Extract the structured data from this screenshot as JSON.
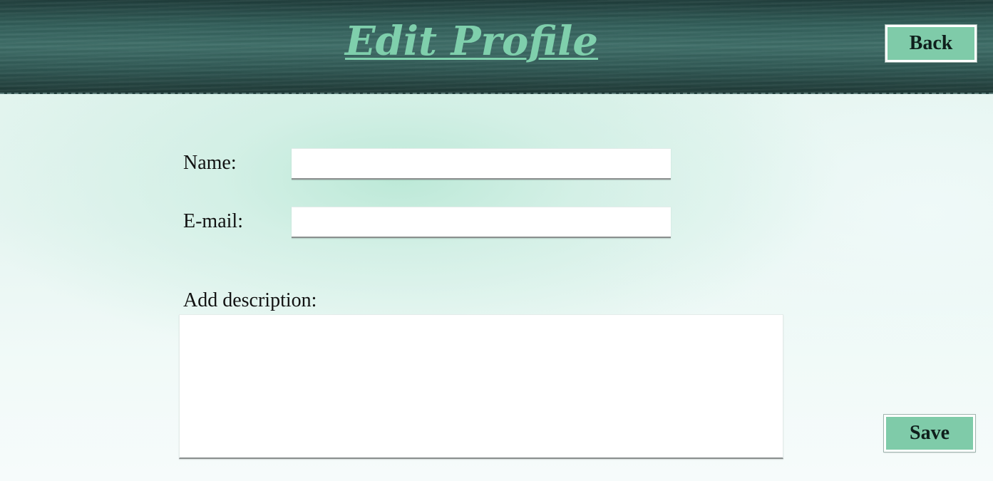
{
  "header": {
    "title": "Edit Profile",
    "back_label": "Back"
  },
  "form": {
    "name_label": "Name:",
    "name_value": "",
    "email_label": "E-mail:",
    "email_value": "",
    "description_label": "Add description:",
    "description_value": ""
  },
  "actions": {
    "save_label": "Save"
  },
  "colors": {
    "accent": "#7fcba9",
    "title": "#7fcfac",
    "header_bg": "#33605b"
  }
}
